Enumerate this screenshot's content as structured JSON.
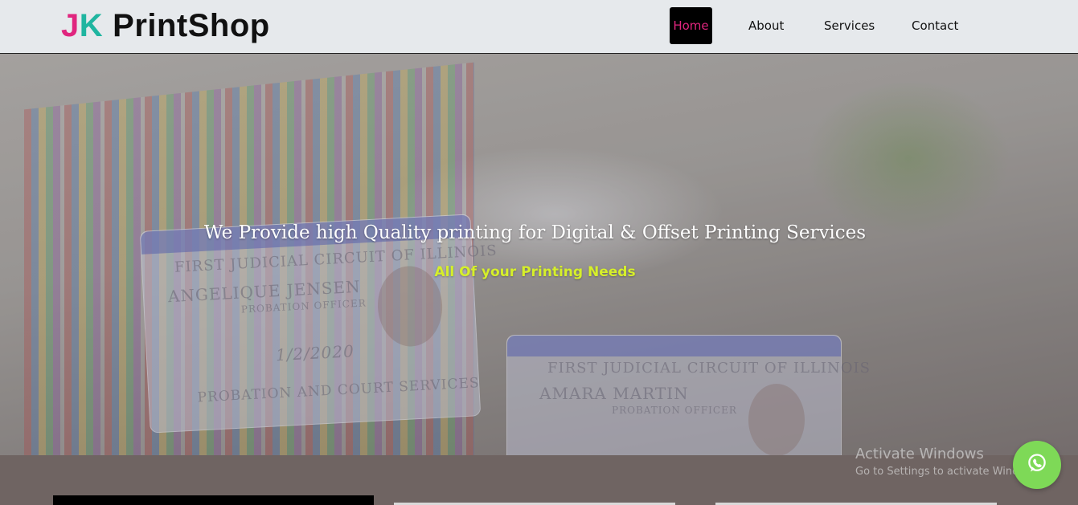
{
  "logo": {
    "part_j": "J",
    "part_k": "K",
    "part_name": "PrintShop"
  },
  "nav": {
    "home": "Home",
    "about": "About",
    "services": "Services",
    "contact": "Contact"
  },
  "hero": {
    "title": "We Provide high Quality printing for Digital & Offset Printing Services",
    "subtitle": "All Of your Printing Needs",
    "card1_line1": "FIRST JUDICIAL CIRCUIT OF ILLINOIS",
    "card1_name": "ANGELIQUE  JENSEN",
    "card1_role": "PROBATION OFFICER",
    "card1_date": "1/2/2020",
    "card1_footer": "PROBATION AND COURT SERVICES",
    "card2_line1": "FIRST JUDICIAL CIRCUIT OF ILLINOIS",
    "card2_name": "AMARA MARTIN",
    "card2_role": "PROBATION OFFICER"
  },
  "watermark": {
    "line1": "Activate Windows",
    "line2": "Go to Settings to activate Windows."
  },
  "colors": {
    "brand_pink": "#e0257e",
    "brand_teal": "#1fb5a0",
    "subtitle_lime": "#d6ef2a",
    "whatsapp_green": "#7ed957"
  },
  "icons": {
    "floating_button": "whatsapp-icon"
  }
}
